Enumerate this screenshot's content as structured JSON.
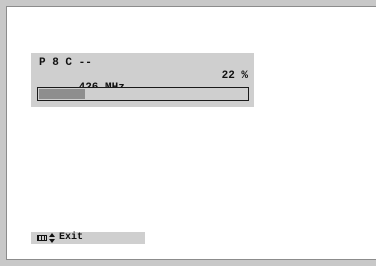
{
  "channel_info": {
    "line1": "P 8 C --",
    "frequency": "426 MHz",
    "percent": "22 %",
    "progress_fraction": 0.22
  },
  "footer": {
    "menu_icon": "menu-icon",
    "updown_icon": "up-down-arrows-icon",
    "exit_label": "Exit"
  }
}
